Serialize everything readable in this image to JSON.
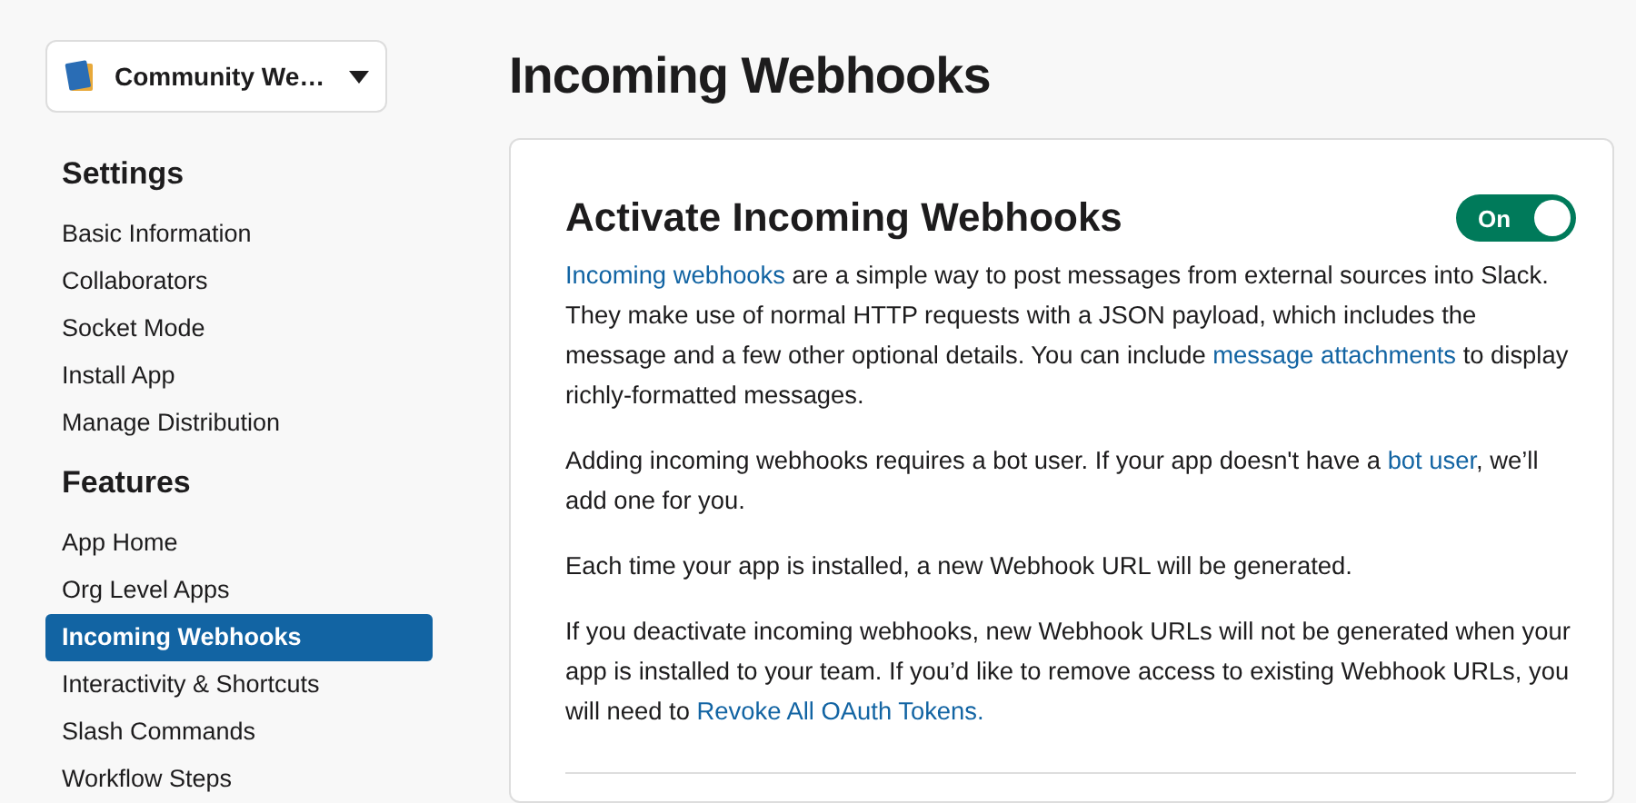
{
  "app_switcher": {
    "label": "Community We…"
  },
  "sidebar": {
    "sections": [
      {
        "title": "Settings",
        "items": [
          {
            "label": "Basic Information",
            "selected": false
          },
          {
            "label": "Collaborators",
            "selected": false
          },
          {
            "label": "Socket Mode",
            "selected": false
          },
          {
            "label": "Install App",
            "selected": false
          },
          {
            "label": "Manage Distribution",
            "selected": false
          }
        ]
      },
      {
        "title": "Features",
        "items": [
          {
            "label": "App Home",
            "selected": false
          },
          {
            "label": "Org Level Apps",
            "selected": false
          },
          {
            "label": "Incoming Webhooks",
            "selected": true
          },
          {
            "label": "Interactivity & Shortcuts",
            "selected": false
          },
          {
            "label": "Slash Commands",
            "selected": false
          },
          {
            "label": "Workflow Steps",
            "selected": false
          }
        ]
      }
    ]
  },
  "page_title": "Incoming Webhooks",
  "card": {
    "title": "Activate Incoming Webhooks",
    "toggle": {
      "label": "On",
      "on": true
    },
    "paragraphs": [
      [
        {
          "text": "Incoming webhooks",
          "link": true
        },
        {
          "text": " are a simple way to post messages from external sources into Slack. They make use of normal HTTP requests with a JSON payload, which includes the message and a few other optional details. You can include ",
          "link": false
        },
        {
          "text": "message attachments",
          "link": true
        },
        {
          "text": " to display richly-formatted messages.",
          "link": false
        }
      ],
      [
        {
          "text": "Adding incoming webhooks requires a bot user. If your app doesn't have a ",
          "link": false
        },
        {
          "text": "bot user",
          "link": true
        },
        {
          "text": ", we’ll add one for you.",
          "link": false
        }
      ],
      [
        {
          "text": "Each time your app is installed, a new Webhook URL will be generated.",
          "link": false
        }
      ],
      [
        {
          "text": "If you deactivate incoming webhooks, new Webhook URLs will not be generated when your app is installed to your team. If you’d like to remove access to existing Webhook URLs, you will need to ",
          "link": false
        },
        {
          "text": "Revoke All OAuth Tokens.",
          "link": true
        }
      ]
    ]
  }
}
